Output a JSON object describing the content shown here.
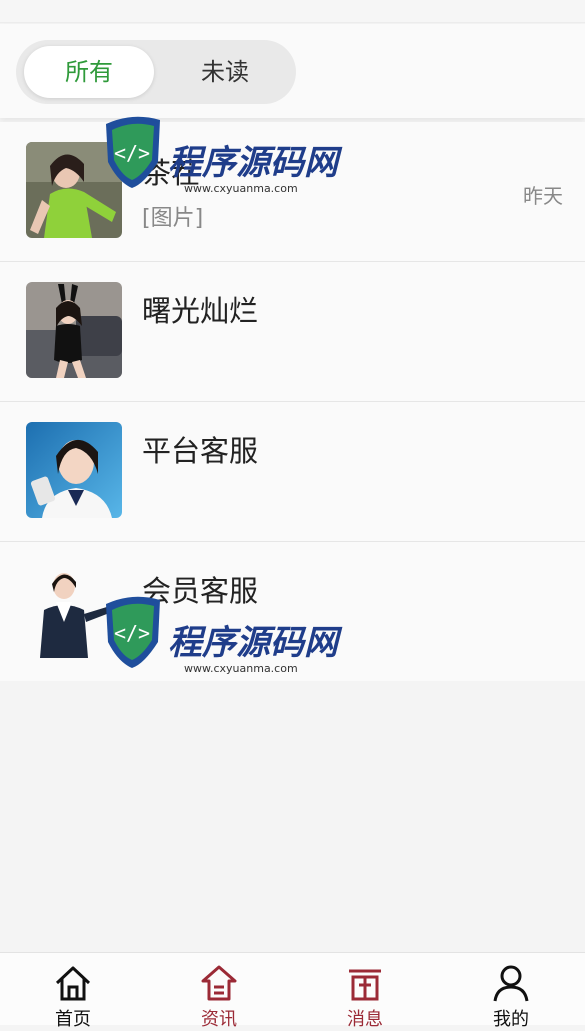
{
  "filter": {
    "all_label": "所有",
    "unread_label": "未读",
    "selected": "all"
  },
  "conversations": [
    {
      "name": "茶茬",
      "preview": "[图片]",
      "time": "昨天",
      "avatar": "avatar-green-outfit"
    },
    {
      "name": "曙光灿烂",
      "preview": "",
      "time": "",
      "avatar": "avatar-bunny-ears"
    },
    {
      "name": "平台客服",
      "preview": "",
      "time": "",
      "avatar": "avatar-service-headset"
    },
    {
      "name": "会员客服",
      "preview": "",
      "time": "",
      "avatar": "avatar-service-uniform"
    }
  ],
  "watermark": {
    "brand": "程序源码网",
    "url": "www.cxyuanma.com"
  },
  "tabbar": {
    "items": [
      {
        "label": "首页",
        "icon": "home-icon"
      },
      {
        "label": "资讯",
        "icon": "news-icon"
      },
      {
        "label": "消息",
        "icon": "message-icon"
      },
      {
        "label": "我的",
        "icon": "user-icon"
      }
    ]
  },
  "colors": {
    "active_filter": "#2f9a3a",
    "tab_accent": "#9b2a36"
  }
}
